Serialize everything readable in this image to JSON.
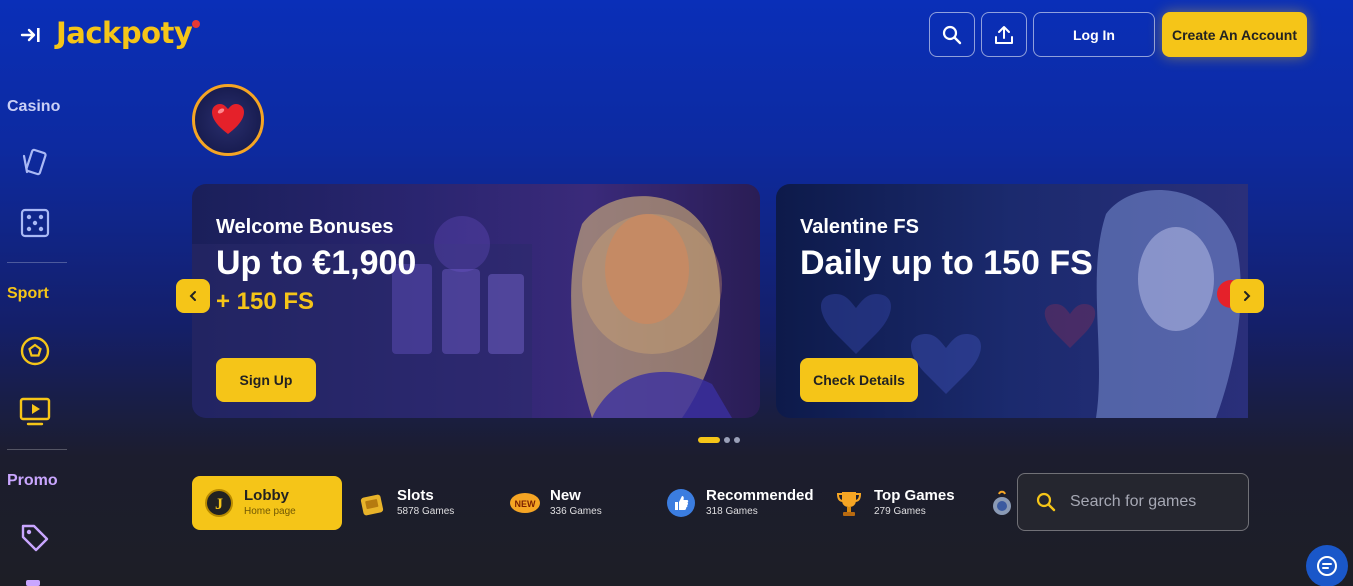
{
  "header": {
    "logo": "Jackpoty",
    "login_label": "Log In",
    "create_label": "Create An Account"
  },
  "sidebar": {
    "casino_label": "Casino",
    "sport_label": "Sport",
    "promo_label": "Promo"
  },
  "banners": [
    {
      "small": "Welcome Bonuses",
      "big": "Up to €1,900",
      "extra": "+ 150 FS",
      "button": "Sign Up"
    },
    {
      "small": "Valentine FS",
      "big": "Daily up to 150 FS",
      "button": "Check Details"
    }
  ],
  "categories": [
    {
      "name": "Lobby",
      "sub": "Home page"
    },
    {
      "name": "Slots",
      "sub": "5878 Games"
    },
    {
      "name": "New",
      "sub": "336 Games"
    },
    {
      "name": "Recommended",
      "sub": "318 Games"
    },
    {
      "name": "Top Games",
      "sub": "279 Games"
    }
  ],
  "search": {
    "placeholder": "Search for games"
  },
  "colors": {
    "accent": "#f5c518",
    "brand_blue": "#0a2fb8"
  }
}
